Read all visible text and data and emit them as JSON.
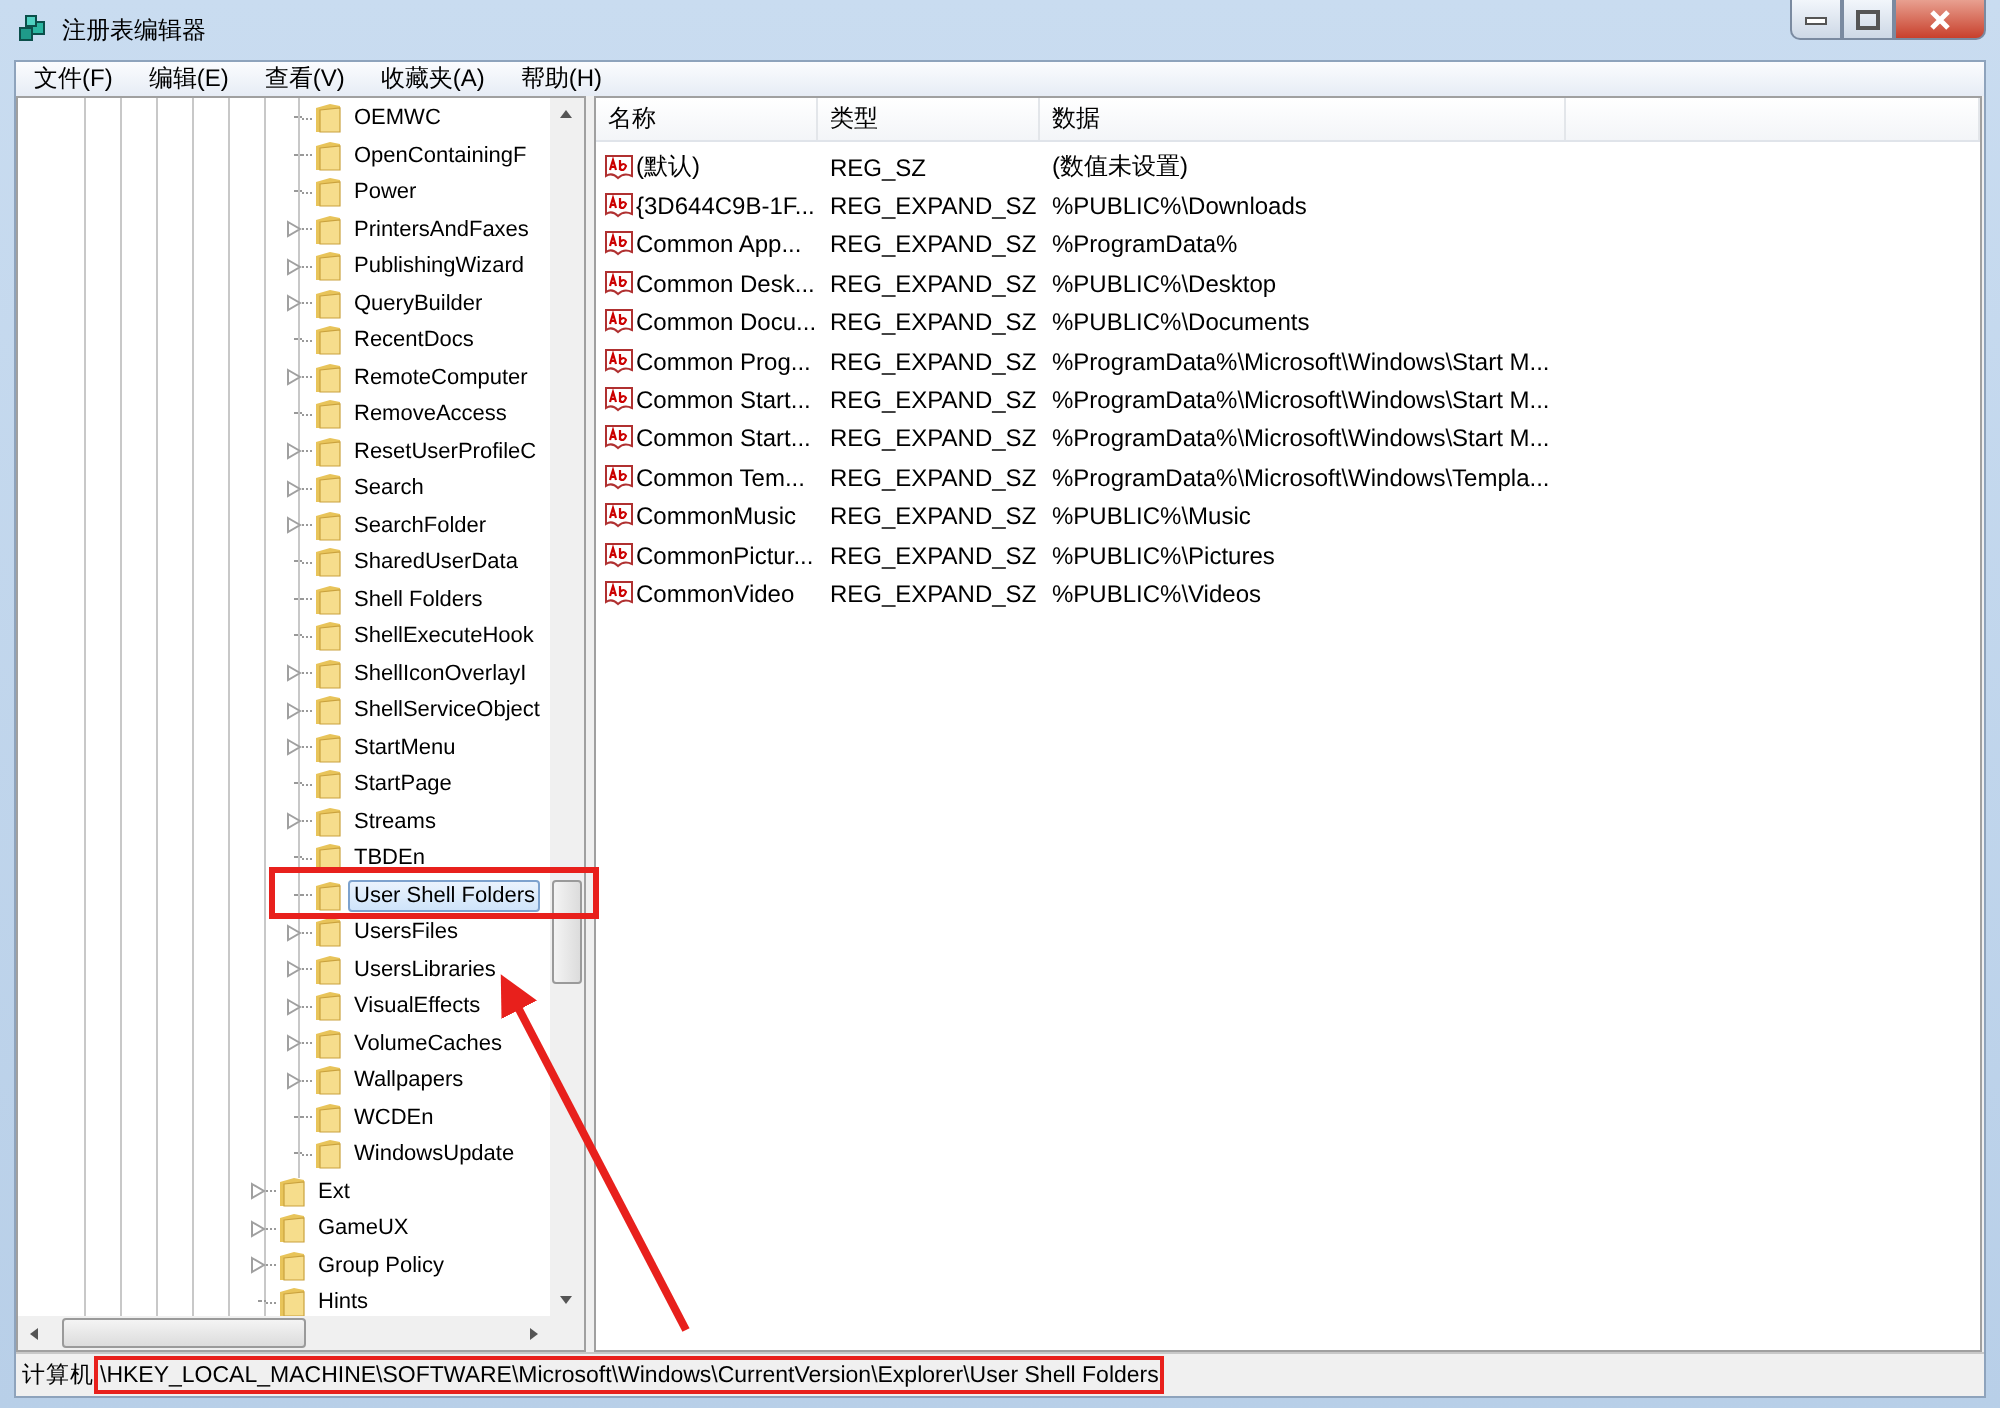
{
  "window": {
    "title": "注册表编辑器"
  },
  "menu": [
    {
      "label": "文件(F)"
    },
    {
      "label": "编辑(E)"
    },
    {
      "label": "查看(V)"
    },
    {
      "label": "收藏夹(A)"
    },
    {
      "label": "帮助(H)"
    }
  ],
  "tree": {
    "nested_items": [
      {
        "label": "OEMWC",
        "has_children": false,
        "selected": false
      },
      {
        "label": "OpenContainingF",
        "has_children": false,
        "selected": false
      },
      {
        "label": "Power",
        "has_children": false,
        "selected": false
      },
      {
        "label": "PrintersAndFaxes",
        "has_children": true,
        "selected": false
      },
      {
        "label": "PublishingWizard",
        "has_children": true,
        "selected": false
      },
      {
        "label": "QueryBuilder",
        "has_children": true,
        "selected": false
      },
      {
        "label": "RecentDocs",
        "has_children": false,
        "selected": false
      },
      {
        "label": "RemoteComputer",
        "has_children": true,
        "selected": false
      },
      {
        "label": "RemoveAccess",
        "has_children": false,
        "selected": false
      },
      {
        "label": "ResetUserProfileC",
        "has_children": true,
        "selected": false
      },
      {
        "label": "Search",
        "has_children": true,
        "selected": false
      },
      {
        "label": "SearchFolder",
        "has_children": true,
        "selected": false
      },
      {
        "label": "SharedUserData",
        "has_children": false,
        "selected": false
      },
      {
        "label": "Shell Folders",
        "has_children": false,
        "selected": false
      },
      {
        "label": "ShellExecuteHook",
        "has_children": false,
        "selected": false
      },
      {
        "label": "ShellIconOverlayI",
        "has_children": true,
        "selected": false
      },
      {
        "label": "ShellServiceObject",
        "has_children": true,
        "selected": false
      },
      {
        "label": "StartMenu",
        "has_children": true,
        "selected": false
      },
      {
        "label": "StartPage",
        "has_children": false,
        "selected": false
      },
      {
        "label": "Streams",
        "has_children": true,
        "selected": false
      },
      {
        "label": "TBDEn",
        "has_children": false,
        "selected": false
      },
      {
        "label": "User Shell Folders",
        "has_children": false,
        "selected": true
      },
      {
        "label": "UsersFiles",
        "has_children": true,
        "selected": false
      },
      {
        "label": "UsersLibraries",
        "has_children": true,
        "selected": false
      },
      {
        "label": "VisualEffects",
        "has_children": true,
        "selected": false
      },
      {
        "label": "VolumeCaches",
        "has_children": true,
        "selected": false
      },
      {
        "label": "Wallpapers",
        "has_children": true,
        "selected": false
      },
      {
        "label": "WCDEn",
        "has_children": false,
        "selected": false
      },
      {
        "label": "WindowsUpdate",
        "has_children": false,
        "selected": false
      }
    ],
    "items": [
      {
        "label": "Ext",
        "has_children": true,
        "selected": false
      },
      {
        "label": "GameUX",
        "has_children": true,
        "selected": false
      },
      {
        "label": "Group Policy",
        "has_children": true,
        "selected": false
      },
      {
        "label": "Hints",
        "has_children": false,
        "selected": false
      }
    ]
  },
  "table": {
    "columns": [
      "名称",
      "类型",
      "数据"
    ],
    "rows": [
      {
        "name": "(默认)",
        "type": "REG_SZ",
        "data": "(数值未设置)"
      },
      {
        "name": "{3D644C9B-1F...",
        "type": "REG_EXPAND_SZ",
        "data": "%PUBLIC%\\Downloads"
      },
      {
        "name": "Common App...",
        "type": "REG_EXPAND_SZ",
        "data": "%ProgramData%"
      },
      {
        "name": "Common Desk...",
        "type": "REG_EXPAND_SZ",
        "data": "%PUBLIC%\\Desktop"
      },
      {
        "name": "Common Docu...",
        "type": "REG_EXPAND_SZ",
        "data": "%PUBLIC%\\Documents"
      },
      {
        "name": "Common Prog...",
        "type": "REG_EXPAND_SZ",
        "data": "%ProgramData%\\Microsoft\\Windows\\Start M..."
      },
      {
        "name": "Common Start...",
        "type": "REG_EXPAND_SZ",
        "data": "%ProgramData%\\Microsoft\\Windows\\Start M..."
      },
      {
        "name": "Common Start...",
        "type": "REG_EXPAND_SZ",
        "data": "%ProgramData%\\Microsoft\\Windows\\Start M..."
      },
      {
        "name": "Common Tem...",
        "type": "REG_EXPAND_SZ",
        "data": "%ProgramData%\\Microsoft\\Windows\\Templa..."
      },
      {
        "name": "CommonMusic",
        "type": "REG_EXPAND_SZ",
        "data": "%PUBLIC%\\Music"
      },
      {
        "name": "CommonPictur...",
        "type": "REG_EXPAND_SZ",
        "data": "%PUBLIC%\\Pictures"
      },
      {
        "name": "CommonVideo",
        "type": "REG_EXPAND_SZ",
        "data": "%PUBLIC%\\Videos"
      }
    ]
  },
  "status_bar": {
    "root": "计算机",
    "path": "\\HKEY_LOCAL_MACHINE\\SOFTWARE\\Microsoft\\Windows\\CurrentVersion\\Explorer\\User Shell Folders"
  }
}
